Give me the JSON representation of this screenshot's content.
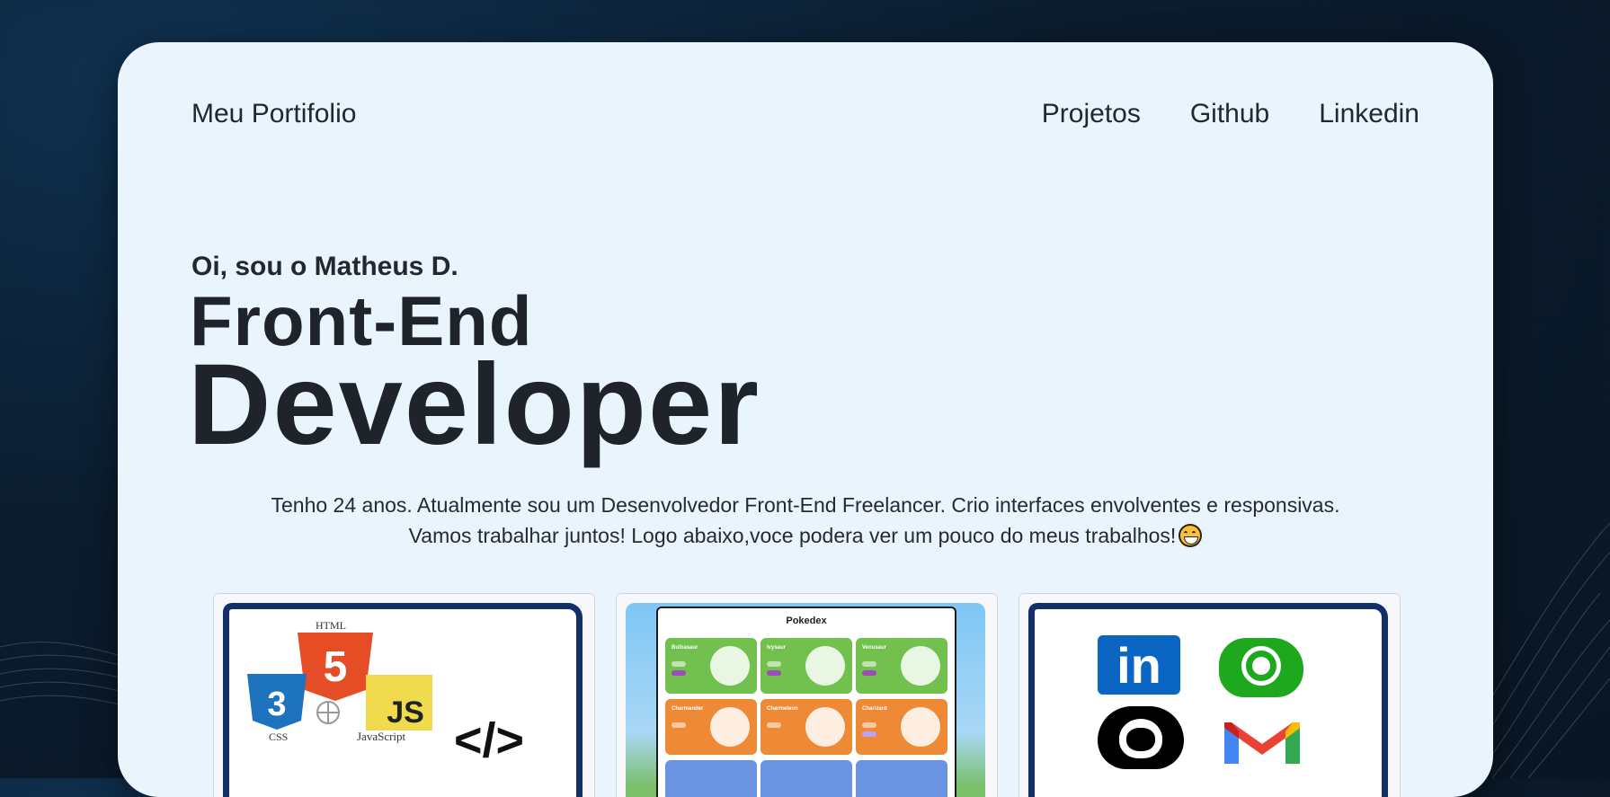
{
  "brand": "Meu Portifolio",
  "nav": [
    "Projetos",
    "Github",
    "Linkedin"
  ],
  "hero": {
    "greeting": "Oi, sou o Matheus D.",
    "role_line1": "Front-End",
    "role_line2": "Developer"
  },
  "description": {
    "line1": "Tenho 24 anos. Atualmente sou um Desenvolvedor Front-End Freelancer. Crio interfaces envolventes e responsivas.",
    "line2": "Vamos trabalhar juntos! Logo abaixo,voce podera ver um pouco do meus trabalhos!",
    "emoji": "grinning-face-icon"
  },
  "projects": {
    "web_skills": {
      "html_label": "HTML",
      "html_badge": "5",
      "css_badge": "3",
      "css_label": "CSS",
      "js_badge": "JS",
      "js_label": "JavaScript",
      "code_symbol": "</>"
    },
    "pokedex": {
      "title": "Pokedex",
      "cards": [
        {
          "name": "Bulbasaur",
          "color": "green"
        },
        {
          "name": "Ivysaur",
          "color": "green"
        },
        {
          "name": "Venusaur",
          "color": "green"
        },
        {
          "name": "Charmander",
          "color": "orange"
        },
        {
          "name": "Charmeleon",
          "color": "orange"
        },
        {
          "name": "Charizard",
          "color": "orange"
        }
      ]
    },
    "contacts": {
      "linkedin_text": "in",
      "icons": [
        "linkedin-icon",
        "whatsapp-icon",
        "github-icon",
        "gmail-icon"
      ]
    }
  },
  "colors": {
    "background": "#0b1c2e",
    "card": "#eaf4fd",
    "text": "#1f232a",
    "frame": "#13306b",
    "html": "#e44d26",
    "css": "#1e73be",
    "js": "#f0db4f"
  }
}
